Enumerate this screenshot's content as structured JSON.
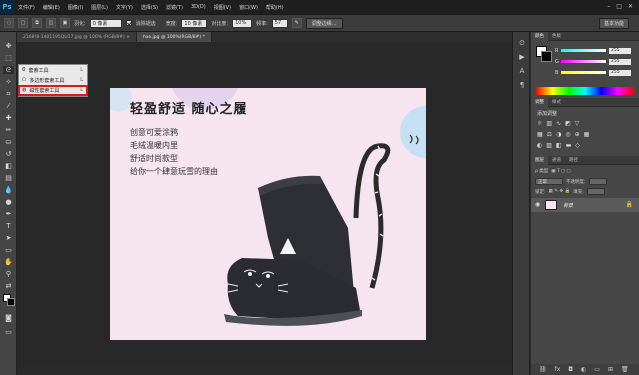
{
  "menubar": {
    "logo": "Ps",
    "items": [
      "文件(F)",
      "编辑(E)",
      "图像(I)",
      "图层(L)",
      "文字(Y)",
      "选择(S)",
      "滤镜(T)",
      "3D(D)",
      "视图(V)",
      "窗口(W)",
      "帮助(H)"
    ],
    "window_controls": [
      "–",
      "□",
      "✕"
    ]
  },
  "options_bar": {
    "feather_label": "羽化:",
    "feather_value": "0 像素",
    "antialias_label": "消除锯齿",
    "width_label": "宽度:",
    "width_value": "10 像素",
    "contrast_label": "对比度:",
    "contrast_value": "10%",
    "frequency_label": "频率:",
    "frequency_value": "57",
    "refine_edge_label": "调整边缘...",
    "workspace_label": "基本功能"
  },
  "tabs": [
    {
      "label": "2168!8-1401195QU17.jpg @ 100% (RGB/8#) ×",
      "active": false
    },
    {
      "label": "hxe.jpg @ 100%(RGB/8#) *",
      "active": true
    }
  ],
  "flyout": {
    "items": [
      {
        "label": "套索工具",
        "key": "L"
      },
      {
        "label": "多边形套索工具",
        "key": "L"
      },
      {
        "label": "磁性套索工具",
        "key": "L"
      }
    ]
  },
  "document": {
    "headline": "轻盈舒适 随心之履",
    "lines": [
      "创意可爱涂鸦",
      "毛绒温暖内里",
      "舒适时尚款型",
      "给你一个肆意玩雪的理由"
    ]
  },
  "color_panel": {
    "tabs": [
      "颜色",
      "色板"
    ],
    "channels": [
      {
        "name": "R",
        "value": "255"
      },
      {
        "name": "G",
        "value": "255"
      },
      {
        "name": "B",
        "value": "255"
      }
    ]
  },
  "adjust_panel": {
    "tabs": [
      "调整",
      "样式"
    ],
    "title": "添加调整"
  },
  "layers_panel": {
    "tabs": [
      "图层",
      "通道",
      "路径"
    ],
    "blend_mode": "正常",
    "opacity_label": "不透明度:",
    "lock_label": "锁定:",
    "fill_label": "填充:",
    "layer_name": "背景"
  },
  "colors": {
    "canvas_bg": "#f6e5ee",
    "highlight": "#e21818",
    "circle_blue": "#c9e1f2",
    "circle_purple": "#e2d2ec"
  }
}
